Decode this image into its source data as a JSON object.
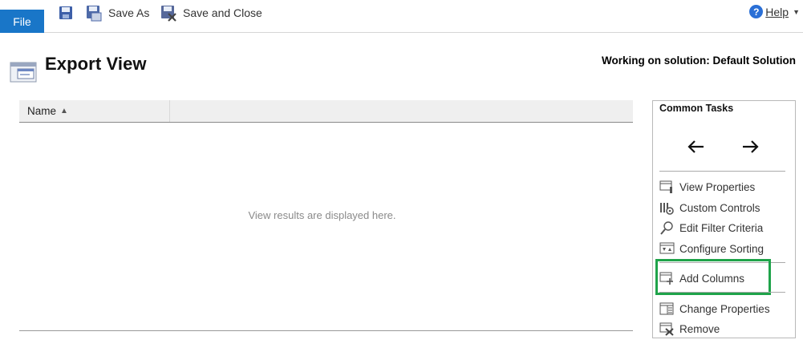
{
  "ribbon": {
    "file_label": "File",
    "save_as_label": "Save As",
    "save_close_label": "Save and Close",
    "help_label": "Help"
  },
  "header": {
    "title": "Export View",
    "solution_text": "Working on solution: Default Solution"
  },
  "grid": {
    "columns": [
      {
        "label": "Name",
        "sort": "ascending"
      }
    ],
    "empty_message": "View results are displayed here."
  },
  "common_tasks": {
    "title": "Common Tasks",
    "items": [
      {
        "label": "View Properties",
        "icon": "view-properties-icon"
      },
      {
        "label": "Custom Controls",
        "icon": "custom-controls-icon"
      },
      {
        "label": "Edit Filter Criteria",
        "icon": "filter-icon"
      },
      {
        "label": "Configure Sorting",
        "icon": "sorting-icon"
      },
      {
        "label": "Add Columns",
        "icon": "add-columns-icon",
        "highlighted": true
      },
      {
        "label": "Change Properties",
        "icon": "change-properties-icon"
      },
      {
        "label": "Remove",
        "icon": "remove-icon"
      }
    ]
  },
  "colors": {
    "file_button": "#1976c8",
    "highlight_border": "#1fa34a",
    "help_icon": "#2a6fd6"
  }
}
